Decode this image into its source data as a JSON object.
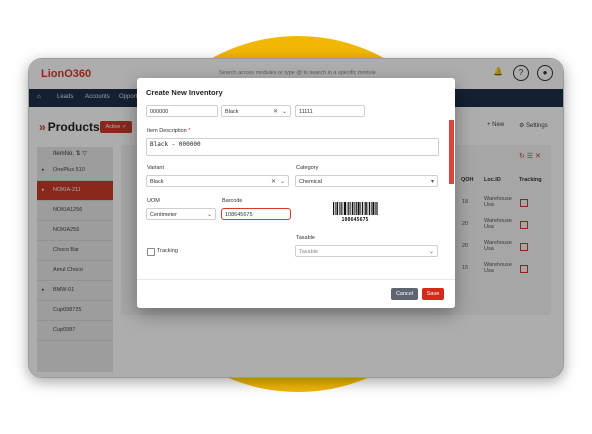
{
  "app": {
    "logo_text": "LionO360",
    "search_placeholder": "Search across modules or type @ to search in a specific module"
  },
  "nav": {
    "items": [
      "Leads",
      "Accounts",
      "Opport"
    ]
  },
  "page": {
    "title": "Products",
    "active_label": "Active",
    "new_label": "New",
    "settings_label": "Settings"
  },
  "list": {
    "header": "ItemNo.",
    "items": [
      "OnePlus 510",
      "NOKIA-211",
      "NOKIA1256",
      "NOKIA256",
      "Choco Bar",
      "Amul Choco",
      "BMW-01",
      "Cup098725",
      "Cup0987"
    ],
    "selected_index": 1
  },
  "table": {
    "headers": [
      "QOH",
      "Loc.ID",
      "Tracking"
    ],
    "rows": [
      {
        "qoh": "18",
        "loc": "Warehouse Usa"
      },
      {
        "qoh": "20",
        "loc": "Warehouse Usa"
      },
      {
        "qoh": "20",
        "loc": "Warehouse Usa"
      },
      {
        "qoh": "15",
        "loc": "Warehouse Usa"
      }
    ]
  },
  "modal": {
    "title": "Create New Inventory",
    "top_row": {
      "code": "000000",
      "color": "Black",
      "qty": "11111"
    },
    "item_description": {
      "label": "Item Description",
      "required_mark": "*",
      "value": "Black - 000000"
    },
    "variant": {
      "label": "Variant",
      "value": "Black"
    },
    "category": {
      "label": "Category",
      "value": "Chemical"
    },
    "uom": {
      "label": "UOM",
      "value": "Centimeter"
    },
    "barcode": {
      "label": "Barcode",
      "value": "108645675",
      "image_number": "108645675"
    },
    "tracking": {
      "label": "Tracking"
    },
    "taxable": {
      "label": "Taxable",
      "placeholder": "Taxable"
    },
    "cancel_label": "Cancel",
    "save_label": "Save"
  },
  "colors": {
    "accent": "#c93a2a",
    "navbar": "#1e2f47",
    "blob": "#f2b705",
    "cancel": "#5e6570"
  }
}
